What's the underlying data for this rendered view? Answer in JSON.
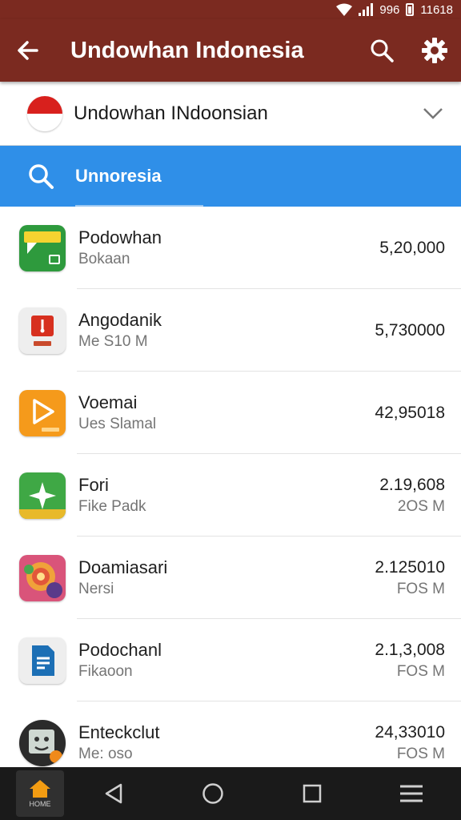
{
  "status_bar": {
    "carrier": "996",
    "time": "11618"
  },
  "app_bar": {
    "title": "Undowhan Indonesia"
  },
  "selector": {
    "label": "Undowhan INdoonsian"
  },
  "search": {
    "query": "Unnoresia"
  },
  "apps": [
    {
      "name": "Podowhan",
      "sub": "Bokaan",
      "count": "5,20,000",
      "size": ""
    },
    {
      "name": "Angodanik",
      "sub": "Me S10 M",
      "count": "5,730000",
      "size": ""
    },
    {
      "name": "Voemai",
      "sub": "Ues Slamal",
      "count": "42,95018",
      "size": ""
    },
    {
      "name": "Fori",
      "sub": "Fike Padk",
      "count": "2.19,608",
      "size": "2OS M"
    },
    {
      "name": "Doamiasari",
      "sub": "Nersi",
      "count": "2.125010",
      "size": "FOS M"
    },
    {
      "name": "Podochanl",
      "sub": "Fikaoon",
      "count": "2.1,3,008",
      "size": "FOS M"
    },
    {
      "name": "Enteckclut",
      "sub": "Me: oso",
      "count": "24,33010",
      "size": "FOS M"
    }
  ],
  "nav": {
    "home_label": "HOME"
  },
  "colors": {
    "app_bar": "#7b2a20",
    "search_bar": "#2f8fe8",
    "nav_bar": "#1a1a1a"
  },
  "icons": [
    "back-arrow-icon",
    "search-icon",
    "settings-gear-icon",
    "chevron-down-icon",
    "home-icon",
    "back-triangle-icon",
    "home-circle-icon",
    "recents-square-icon",
    "menu-icon"
  ]
}
